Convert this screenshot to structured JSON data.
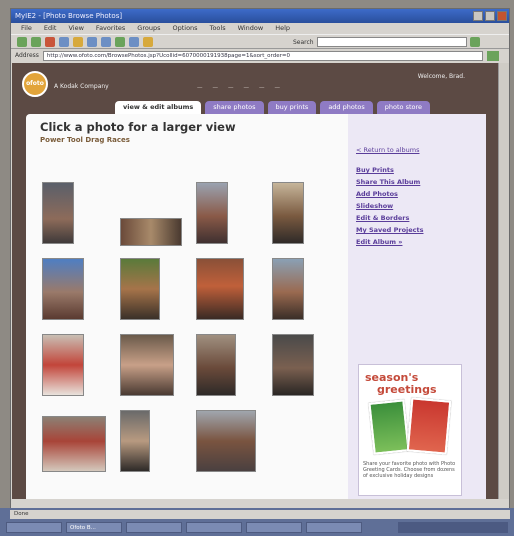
{
  "browser": {
    "title": "MyIE2 - [Photo Browse Photos]",
    "menu": [
      "File",
      "Edit",
      "View",
      "Favorites",
      "Groups",
      "Options",
      "Tools",
      "Window",
      "Help"
    ],
    "search_label": "Search",
    "address_label": "Address",
    "url": "http://www.ofoto.com/BrowsePhotos.jsp?Ucollid=6070000191938page=1&sort_order=0"
  },
  "site": {
    "logo_text": "ofoto",
    "company": "A Kodak Company",
    "welcome": "Welcome, Brad.",
    "tabs": [
      "view & edit albums",
      "share photos",
      "buy prints",
      "add photos",
      "photo store"
    ],
    "active_tab": 0
  },
  "main": {
    "page_title": "Click a photo for a larger view",
    "album_title": "Power Tool Drag Races"
  },
  "sidebar": {
    "links": [
      "< Return to albums",
      "Buy Prints",
      "Share This Album",
      "Add Photos",
      "Slideshow",
      "Edit & Borders",
      "My Saved Projects",
      "Edit Album »"
    ]
  },
  "promo": {
    "line1": "season's",
    "line2": "greetings",
    "text": "Share your favorite photo with Photo Greeting Cards. Choose from dozens of exclusive holiday designs"
  },
  "statusbar": {
    "text": "Done"
  },
  "taskbar": {
    "tasks": [
      "Ofoto B..."
    ]
  },
  "colors": {
    "accent": "#8f7bc4",
    "frame": "#5c4a44",
    "link": "#5a3d9a"
  }
}
